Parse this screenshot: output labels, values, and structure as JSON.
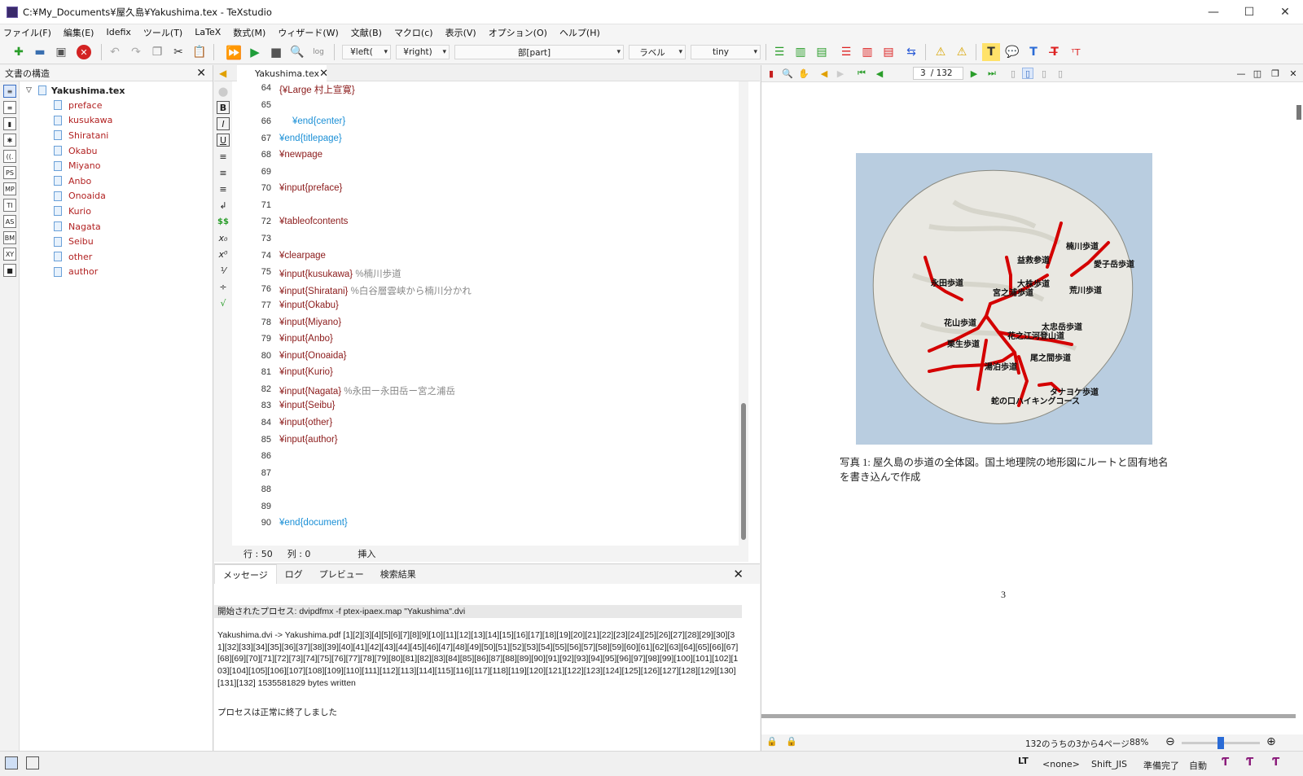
{
  "window": {
    "title": "C:¥My_Documents¥屋久島¥Yakushima.tex - TeXstudio",
    "minimize": "—",
    "maximize": "☐",
    "close": "✕"
  },
  "menu": [
    "ファイル(F)",
    "編集(E)",
    "Idefix",
    "ツール(T)",
    "LaTeX",
    "数式(M)",
    "ウィザード(W)",
    "文献(B)",
    "マクロ(c)",
    "表示(V)",
    "オプション(O)",
    "ヘルプ(H)"
  ],
  "toolbar": {
    "left_combo": "¥left(",
    "right_combo": "¥right)",
    "section_combo": "部[part]",
    "label_combo": "ラベル",
    "size_combo": "tiny"
  },
  "structure": {
    "title": "文書の構造",
    "root": "Yakushima.tex",
    "items": [
      "preface",
      "kusukawa",
      "Shiratani",
      "Okabu",
      "Miyano",
      "Anbo",
      "Onoaida",
      "Kurio",
      "Nagata",
      "Seibu",
      "other",
      "author"
    ],
    "side_icons": [
      "≡",
      "≡",
      "▮",
      "✱",
      "((.",
      "PS",
      "MP",
      "TI",
      "AS",
      "BM",
      "XY",
      "■"
    ]
  },
  "editor": {
    "tab": "Yakushima.tex",
    "lines": [
      {
        "n": "64",
        "text": "{¥Large 村上宣寛}",
        "kind": "cmd",
        "indent": 0
      },
      {
        "n": "65",
        "text": "",
        "kind": "cmd",
        "indent": 0
      },
      {
        "n": "66",
        "text": "¥end{center}",
        "kind": "env",
        "indent": 1
      },
      {
        "n": "67",
        "text": "¥end{titlepage}",
        "kind": "env",
        "indent": 0
      },
      {
        "n": "68",
        "text": "¥newpage",
        "kind": "cmd",
        "indent": 0
      },
      {
        "n": "69",
        "text": "",
        "kind": "cmd",
        "indent": 0
      },
      {
        "n": "70",
        "text": "¥input{preface}",
        "kind": "cmd",
        "indent": 0
      },
      {
        "n": "71",
        "text": "",
        "kind": "cmd",
        "indent": 0
      },
      {
        "n": "72",
        "text": "¥tableofcontents",
        "kind": "cmd",
        "indent": 0
      },
      {
        "n": "73",
        "text": "",
        "kind": "cmd",
        "indent": 0
      },
      {
        "n": "74",
        "text": "¥clearpage",
        "kind": "cmd",
        "indent": 0
      },
      {
        "n": "75",
        "text": "¥input{kusukawa}",
        "comment": " %楠川歩道",
        "kind": "cmd",
        "indent": 0
      },
      {
        "n": "76",
        "text": "¥input{Shiratani}",
        "comment": " %白谷層雲峡から楠川分かれ",
        "kind": "cmd",
        "indent": 0
      },
      {
        "n": "77",
        "text": "¥input{Okabu}",
        "kind": "cmd",
        "indent": 0
      },
      {
        "n": "78",
        "text": "¥input{Miyano}",
        "kind": "cmd",
        "indent": 0
      },
      {
        "n": "79",
        "text": "¥input{Anbo}",
        "kind": "cmd",
        "indent": 0
      },
      {
        "n": "80",
        "text": "¥input{Onoaida}",
        "kind": "cmd",
        "indent": 0
      },
      {
        "n": "81",
        "text": "¥input{Kurio}",
        "kind": "cmd",
        "indent": 0
      },
      {
        "n": "82",
        "text": "¥input{Nagata}",
        "comment": " %永田ー永田岳ー宮之浦岳",
        "kind": "cmd",
        "indent": 0
      },
      {
        "n": "83",
        "text": "¥input{Seibu}",
        "kind": "cmd",
        "indent": 0
      },
      {
        "n": "84",
        "text": "¥input{other}",
        "kind": "cmd",
        "indent": 0
      },
      {
        "n": "85",
        "text": "¥input{author}",
        "kind": "cmd",
        "indent": 0
      },
      {
        "n": "86",
        "text": "",
        "kind": "cmd",
        "indent": 0
      },
      {
        "n": "87",
        "text": "",
        "kind": "cmd",
        "indent": 0
      },
      {
        "n": "88",
        "text": "",
        "kind": "cmd",
        "indent": 0
      },
      {
        "n": "89",
        "text": "",
        "kind": "cmd",
        "indent": 0
      },
      {
        "n": "90",
        "text": "¥end{document}",
        "kind": "env",
        "indent": 0
      }
    ],
    "status_row": "行 : 50",
    "status_col": "列 : 0",
    "status_mode": "挿入"
  },
  "messages": {
    "tabs": [
      "メッセージ",
      "ログ",
      "プレビュー",
      "検索結果"
    ],
    "process": "開始されたプロセス: dvipdfmx -f ptex-ipaex.map \"Yakushima\".dvi",
    "output": "Yakushima.dvi -> Yakushima.pdf [1][2][3][4][5][6][7][8][9][10][11][12][13][14][15][16][17][18][19][20][21][22][23][24][25][26][27][28][29][30][31][32][33][34][35][36][37][38][39][40][41][42][43][44][45][46][47][48][49][50][51][52][53][54][55][56][57][58][59][60][61][62][63][64][65][66][67][68][69][70][71][72][73][74][75][76][77][78][79][80][81][82][83][84][85][86][87][88][89][90][91][92][93][94][95][96][97][98][99][100][101][102][103][104][105][106][107][108][109][110][111][112][113][114][115][116][117][118][119][120][121][122][123][124][125][126][127][128][129][130][131][132] 1535581829 bytes written",
    "done": "プロセスは正常に終了しました"
  },
  "viewer": {
    "page_input": "3",
    "page_total": "/ 132",
    "caption": "写真 1: 屋久島の歩道の全体図。国土地理院の地形図にルートと固有地名を書き込んで作成",
    "page_number": "3",
    "status_pages": "132のうちの3から4ページ",
    "zoom": "88%",
    "zoom_level": 0.5,
    "map_labels": [
      "楠川歩道",
      "益救参道",
      "愛子岳歩道",
      "永田歩道",
      "大株歩道",
      "宮之浦歩道",
      "荒川歩道",
      "花山歩道",
      "太忠岳歩道",
      "花之江河登山道",
      "栗生歩道",
      "尾之間歩道",
      "湯泊歩道",
      "タナヨケ歩道",
      "蛇の口ハイキングコース"
    ]
  },
  "statusbar": {
    "lang": "<none>",
    "encoding": "Shift_JIS",
    "ready": "準備完了",
    "auto": "自動"
  },
  "colors": {
    "command": "#8b1a1a",
    "environment": "#1a8fd6",
    "comment": "#888888",
    "route": "#d40000"
  }
}
